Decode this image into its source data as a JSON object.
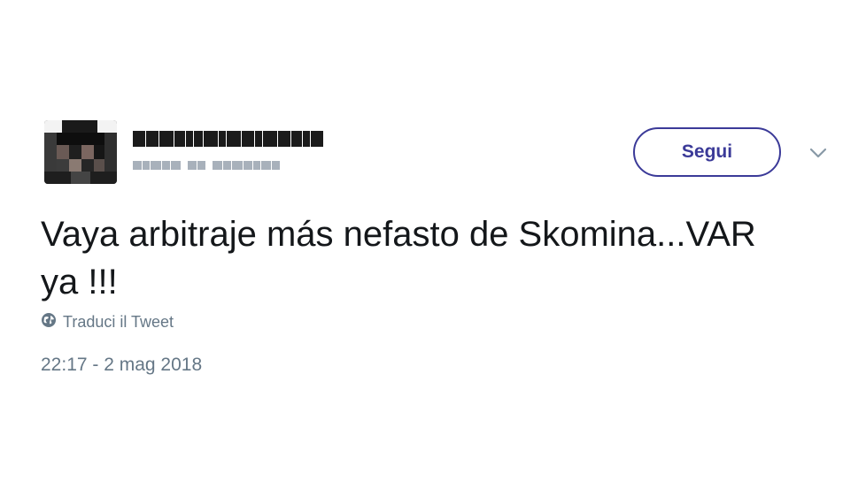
{
  "tweet": {
    "author": {
      "display_name_obscured": true,
      "handle_obscured": true,
      "avatar_obscured": true
    },
    "follow_label": "Segui",
    "menu_icon": "chevron-down-icon",
    "text_line1": "Vaya arbitraje más nefasto de Skomina...VAR",
    "text_line2": "ya !!!",
    "translate_icon": "globe-icon",
    "translate_label": "Traduci il Tweet",
    "timestamp": "22:17 - 2 mag 2018"
  },
  "colors": {
    "accent": "#3b3a98",
    "text": "#14171a",
    "secondary_text": "#657786"
  }
}
